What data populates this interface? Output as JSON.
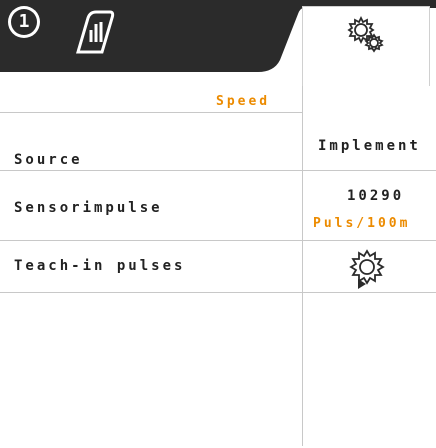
{
  "header": {
    "badge_number": "1",
    "tab_manual_icon": "manual-operation-icon",
    "tab_settings_icon": "settings-gear-icon",
    "colors": {
      "dark": "#2b2b2b",
      "accent": "#ec8b00"
    }
  },
  "speed": {
    "label": "Speed"
  },
  "source": {
    "label": "Source",
    "value": "Implement"
  },
  "sensorimpulse": {
    "label": "Sensorimpulse",
    "value": "10290",
    "unit": "Puls/100m"
  },
  "teach_in": {
    "label": "Teach-in pulses",
    "icon": "gear-play-icon"
  }
}
